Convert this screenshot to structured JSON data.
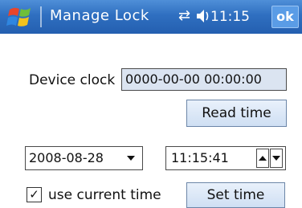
{
  "titlebar": {
    "title": "Manage Lock",
    "time": "11:15",
    "ok_label": "ok",
    "start_icon": "windows-flag-icon",
    "connectivity_icon": "connectivity-icon",
    "volume_icon": "speaker-icon",
    "accent_color": "#2f6fc0"
  },
  "device": {
    "clock_label": "Device clock",
    "clock_value": "0000-00-00 00:00:00",
    "read_time_label": "Read time"
  },
  "setter": {
    "date_value": "2008-08-28",
    "time_value": "11:15:41",
    "use_current_label": "use current time",
    "use_current_checked": true,
    "set_time_label": "Set time"
  }
}
